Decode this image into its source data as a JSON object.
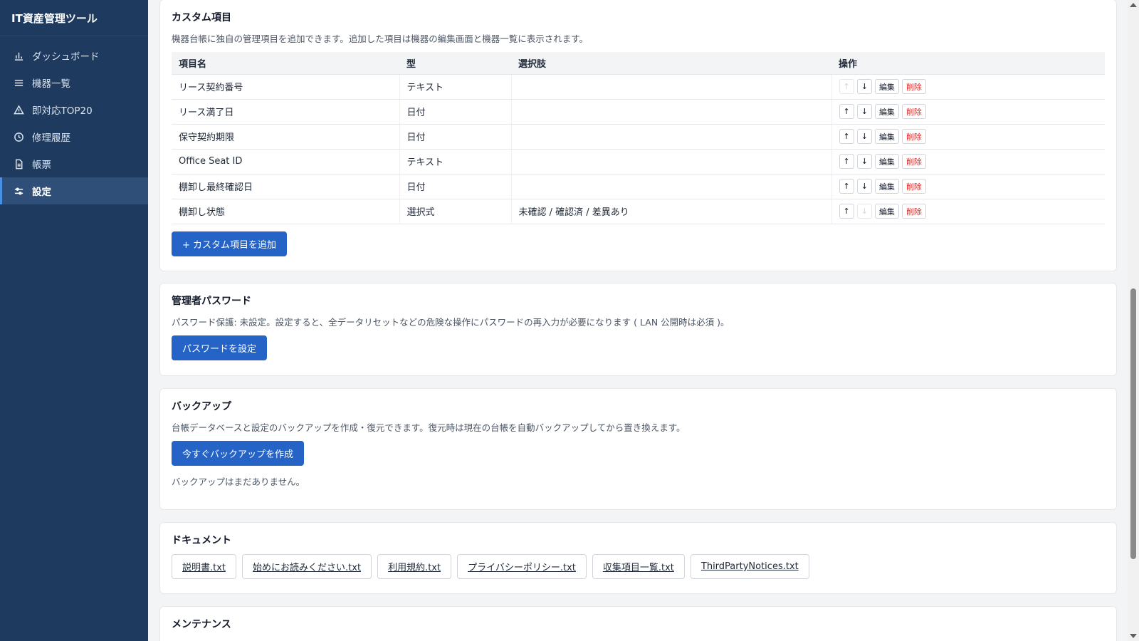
{
  "app": {
    "title": "IT資産管理ツール"
  },
  "sidebar": {
    "items": [
      {
        "label": "ダッシュボード",
        "icon": "bar-chart-icon"
      },
      {
        "label": "機器一覧",
        "icon": "list-icon"
      },
      {
        "label": "即対応TOP20",
        "icon": "warning-icon"
      },
      {
        "label": "修理履歴",
        "icon": "clock-icon"
      },
      {
        "label": "帳票",
        "icon": "document-icon"
      },
      {
        "label": "設定",
        "icon": "sliders-icon",
        "active": true
      }
    ]
  },
  "custom_fields": {
    "title": "カスタム項目",
    "description": "機器台帳に独自の管理項目を追加できます。追加した項目は機器の編集画面と機器一覧に表示されます。",
    "columns": [
      "項目名",
      "型",
      "選択肢",
      "操作"
    ],
    "rows": [
      {
        "name": "リース契約番号",
        "type": "テキスト",
        "options": ""
      },
      {
        "name": "リース満了日",
        "type": "日付",
        "options": ""
      },
      {
        "name": "保守契約期限",
        "type": "日付",
        "options": ""
      },
      {
        "name": "Office Seat ID",
        "type": "テキスト",
        "options": ""
      },
      {
        "name": "棚卸し最終確認日",
        "type": "日付",
        "options": ""
      },
      {
        "name": "棚卸し状態",
        "type": "選択式",
        "options": "未確認 / 確認済 / 差異あり"
      }
    ],
    "up_label": "↑",
    "down_label": "↓",
    "edit_label": "編集",
    "delete_label": "削除",
    "add_label": "+ カスタム項目を追加"
  },
  "admin_password": {
    "title": "管理者パスワード",
    "description": "パスワード保護: 未設定。設定すると、全データリセットなどの危険な操作にパスワードの再入力が必要になります ( LAN 公開時は必須 )。",
    "button_label": "パスワードを設定"
  },
  "backup": {
    "title": "バックアップ",
    "description": "台帳データベースと設定のバックアップを作成・復元できます。復元時は現在の台帳を自動バックアップしてから置き換えます。",
    "button_label": "今すぐバックアップを作成",
    "empty_text": "バックアップはまだありません。"
  },
  "documents": {
    "title": "ドキュメント",
    "links": [
      "説明書.txt",
      "始めにお読みください.txt",
      "利用規約.txt",
      "プライバシーポリシー.txt",
      "収集項目一覧.txt",
      "ThirdPartyNotices.txt"
    ]
  },
  "maintenance": {
    "title": "メンテナンス"
  },
  "colors": {
    "sidebar_bg": "#1e3a5f",
    "primary": "#2563c7",
    "danger": "#dc2626"
  }
}
